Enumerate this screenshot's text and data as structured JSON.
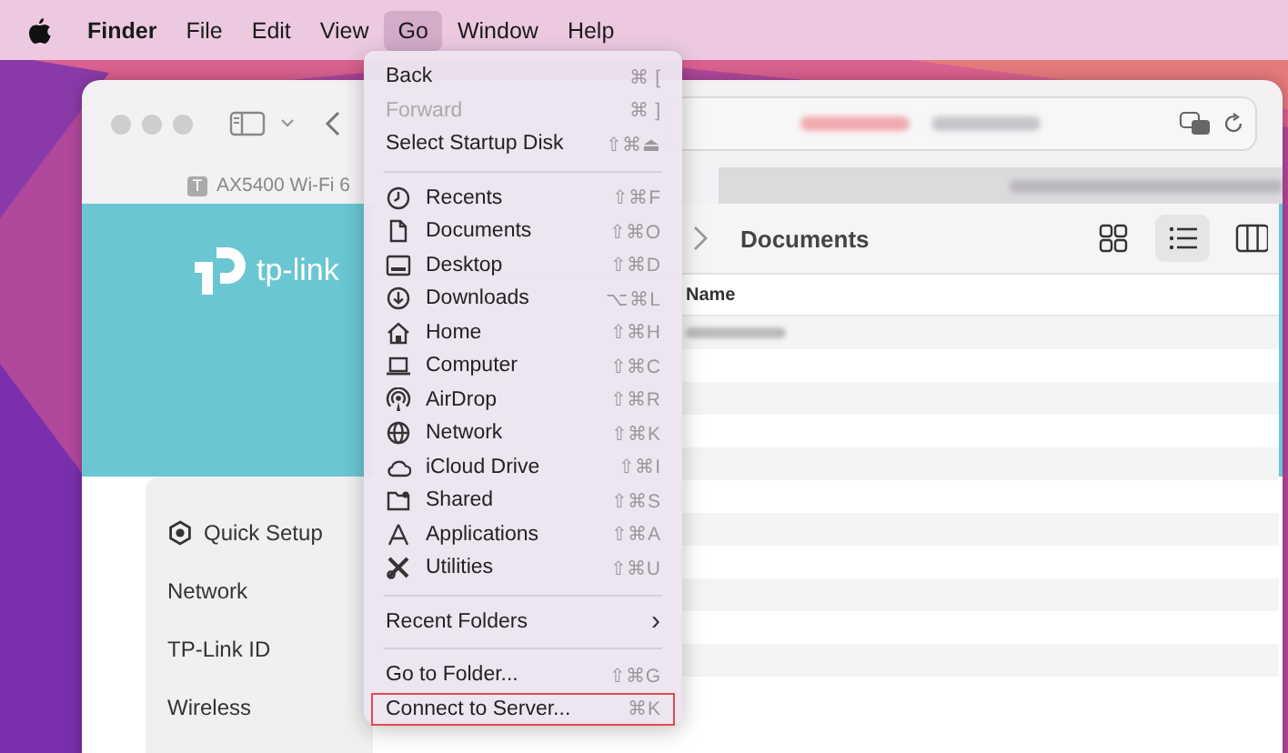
{
  "menubar": {
    "items": [
      {
        "label": "Finder",
        "selected": false,
        "kind": "app"
      },
      {
        "label": "File",
        "selected": false,
        "kind": "menu"
      },
      {
        "label": "Edit",
        "selected": false,
        "kind": "menu"
      },
      {
        "label": "View",
        "selected": false,
        "kind": "menu"
      },
      {
        "label": "Go",
        "selected": true,
        "kind": "menu"
      },
      {
        "label": "Window",
        "selected": false,
        "kind": "menu"
      },
      {
        "label": "Help",
        "selected": false,
        "kind": "menu"
      }
    ]
  },
  "browser": {
    "tab": {
      "favicon": "T",
      "title": "AX5400 Wi-Fi 6"
    },
    "logo": "tp-link",
    "nav": [
      {
        "label": "Quick Setup",
        "kind": "icon"
      },
      {
        "label": "Network",
        "kind": "plain"
      },
      {
        "label": "TP-Link ID",
        "kind": "plain"
      },
      {
        "label": "Wireless",
        "kind": "plain"
      }
    ]
  },
  "finder": {
    "title": "Documents",
    "views": [
      {
        "kind": "icons",
        "selected": false
      },
      {
        "kind": "list",
        "selected": true
      },
      {
        "kind": "columns",
        "selected": false
      }
    ],
    "columns": [
      "Name"
    ]
  },
  "go_menu": {
    "sections": [
      {
        "items": [
          {
            "label": "Back",
            "shortcut": "⌘ [",
            "disabled": false,
            "selected": false
          },
          {
            "label": "Forward",
            "shortcut": "⌘ ]",
            "disabled": true,
            "selected": false
          },
          {
            "label": "Select Startup Disk",
            "shortcut": "⇧⌘⏏",
            "disabled": false,
            "selected": false
          }
        ]
      },
      {
        "items": [
          {
            "label": "Recents",
            "shortcut": "⇧⌘F",
            "disabled": false,
            "selected": false
          },
          {
            "label": "Documents",
            "shortcut": "⇧⌘O",
            "disabled": false,
            "selected": false
          },
          {
            "label": "Desktop",
            "shortcut": "⇧⌘D",
            "disabled": false,
            "selected": false
          },
          {
            "label": "Downloads",
            "shortcut": "⌥⌘L",
            "disabled": false,
            "selected": false
          },
          {
            "label": "Home",
            "shortcut": "⇧⌘H",
            "disabled": false,
            "selected": false
          },
          {
            "label": "Computer",
            "shortcut": "⇧⌘C",
            "disabled": false,
            "selected": false
          },
          {
            "label": "AirDrop",
            "shortcut": "⇧⌘R",
            "disabled": false,
            "selected": false
          },
          {
            "label": "Network",
            "shortcut": "⇧⌘K",
            "disabled": false,
            "selected": false
          },
          {
            "label": "iCloud Drive",
            "shortcut": "⇧⌘I",
            "disabled": false,
            "selected": false
          },
          {
            "label": "Shared",
            "shortcut": "⇧⌘S",
            "disabled": false,
            "selected": false
          },
          {
            "label": "Applications",
            "shortcut": "⇧⌘A",
            "disabled": false,
            "selected": false
          },
          {
            "label": "Utilities",
            "shortcut": "⇧⌘U",
            "disabled": false,
            "selected": false
          }
        ],
        "kind": "places"
      },
      {
        "items": [
          {
            "label": "Recent Folders",
            "arrow": "›",
            "disabled": false,
            "selected": false
          }
        ]
      },
      {
        "items": [
          {
            "label": "Go to Folder...",
            "shortcut": "⇧⌘G",
            "disabled": false,
            "selected": false
          },
          {
            "label": "Connect to Server...",
            "shortcut": "⌘K",
            "disabled": false,
            "selected": true
          }
        ]
      }
    ]
  }
}
